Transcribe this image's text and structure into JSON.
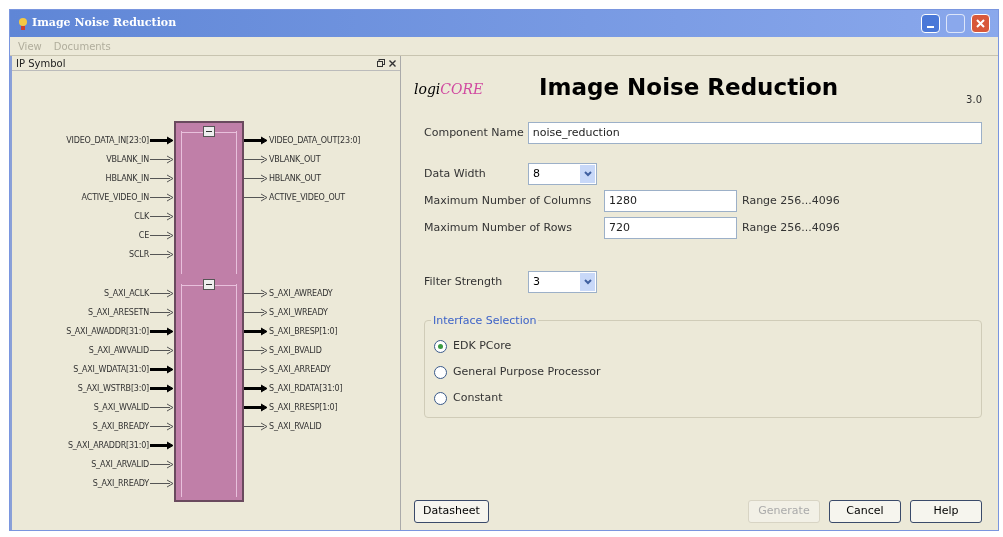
{
  "window": {
    "title": "Image Noise Reduction"
  },
  "menu": [
    {
      "label": "View",
      "disabled": true
    },
    {
      "label": "Documents",
      "disabled": true
    }
  ],
  "symbol_panel": {
    "title": "IP Symbol",
    "groups": [
      {
        "inputs": [
          {
            "name": "VIDEO_DATA_IN[23:0]",
            "kind": "bus"
          },
          {
            "name": "VBLANK_IN",
            "kind": "wire"
          },
          {
            "name": "HBLANK_IN",
            "kind": "wire"
          },
          {
            "name": "ACTIVE_VIDEO_IN",
            "kind": "wire"
          },
          {
            "name": "CLK",
            "kind": "wire"
          },
          {
            "name": "CE",
            "kind": "wire"
          },
          {
            "name": "SCLR",
            "kind": "wire"
          }
        ],
        "outputs": [
          {
            "name": "VIDEO_DATA_OUT[23:0]",
            "kind": "bus"
          },
          {
            "name": "VBLANK_OUT",
            "kind": "wire"
          },
          {
            "name": "HBLANK_OUT",
            "kind": "wire"
          },
          {
            "name": "ACTIVE_VIDEO_OUT",
            "kind": "wire"
          }
        ]
      },
      {
        "inputs": [
          {
            "name": "S_AXI_ACLK",
            "kind": "wire"
          },
          {
            "name": "S_AXI_ARESETN",
            "kind": "wire"
          },
          {
            "name": "S_AXI_AWADDR[31:0]",
            "kind": "bus"
          },
          {
            "name": "S_AXI_AWVALID",
            "kind": "wire"
          },
          {
            "name": "S_AXI_WDATA[31:0]",
            "kind": "bus"
          },
          {
            "name": "S_AXI_WSTRB[3:0]",
            "kind": "bus"
          },
          {
            "name": "S_AXI_WVALID",
            "kind": "wire"
          },
          {
            "name": "S_AXI_BREADY",
            "kind": "wire"
          },
          {
            "name": "S_AXI_ARADDR[31:0]",
            "kind": "bus"
          },
          {
            "name": "S_AXI_ARVALID",
            "kind": "wire"
          },
          {
            "name": "S_AXI_RREADY",
            "kind": "wire"
          }
        ],
        "outputs": [
          {
            "name": "S_AXI_AWREADY",
            "kind": "wire"
          },
          {
            "name": "S_AXI_WREADY",
            "kind": "wire"
          },
          {
            "name": "S_AXI_BRESP[1:0]",
            "kind": "bus"
          },
          {
            "name": "S_AXI_BVALID",
            "kind": "wire"
          },
          {
            "name": "S_AXI_ARREADY",
            "kind": "wire"
          },
          {
            "name": "S_AXI_RDATA[31:0]",
            "kind": "bus"
          },
          {
            "name": "S_AXI_RRESP[1:0]",
            "kind": "bus"
          },
          {
            "name": "S_AXI_RVALID",
            "kind": "wire"
          }
        ]
      }
    ]
  },
  "header": {
    "logo_prefix": "logi",
    "logo_suffix": "CORE",
    "title": "Image Noise Reduction",
    "version": "3.0"
  },
  "component_name": {
    "label": "Component Name",
    "value": "noise_reduction"
  },
  "data_width": {
    "label": "Data Width",
    "value": "8"
  },
  "max_columns": {
    "label": "Maximum Number of Columns",
    "value": "1280",
    "range": "Range 256...4096"
  },
  "max_rows": {
    "label": "Maximum Number of Rows",
    "value": "720",
    "range": "Range 256...4096"
  },
  "filter_strength": {
    "label": "Filter Strength",
    "value": "3"
  },
  "interface_selection": {
    "title": "Interface Selection",
    "options": [
      {
        "label": "EDK PCore",
        "selected": true
      },
      {
        "label": "General Purpose Processor",
        "selected": false
      },
      {
        "label": "Constant",
        "selected": false
      }
    ]
  },
  "datasheet_button": {
    "label": "Datasheet"
  },
  "buttons": [
    {
      "label": "Generate",
      "disabled": true
    },
    {
      "label": "Cancel",
      "disabled": false
    },
    {
      "label": "Help",
      "disabled": false
    }
  ]
}
